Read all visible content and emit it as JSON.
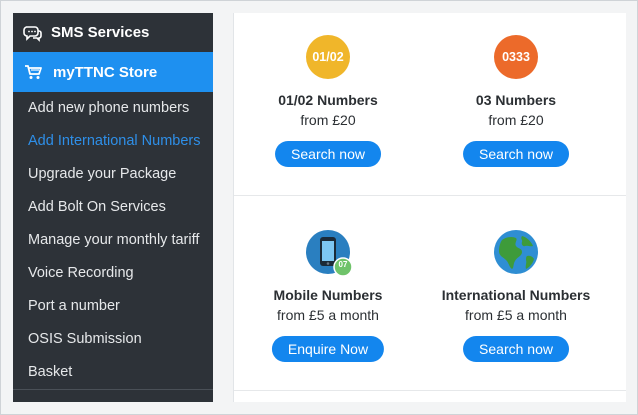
{
  "colors": {
    "sidebar_bg": "#2d3238",
    "active_blue": "#1e90f0",
    "link_blue": "#2e8fe8",
    "button_blue": "#1386ee",
    "badge_yellow": "#f0b62a",
    "badge_orange": "#ec6a2a"
  },
  "sidebar": {
    "header": {
      "label": "SMS Services",
      "icon": "chat-bubbles-icon"
    },
    "store": {
      "label": "myTTNC Store",
      "icon": "shopping-cart-icon"
    },
    "items": [
      {
        "label": "Add new phone numbers",
        "active": false
      },
      {
        "label": "Add International Numbers",
        "active": true
      },
      {
        "label": "Upgrade your Package",
        "active": false
      },
      {
        "label": "Add Bolt On Services",
        "active": false
      },
      {
        "label": "Manage your monthly tariff",
        "active": false
      },
      {
        "label": "Voice Recording",
        "active": false
      },
      {
        "label": "Port a number",
        "active": false
      },
      {
        "label": "OSIS Submission",
        "active": false
      },
      {
        "label": "Basket",
        "active": false
      }
    ]
  },
  "products": [
    {
      "badge": "01/02",
      "title": "01/02 Numbers",
      "price": "from £20",
      "button": "Search now"
    },
    {
      "badge": "0333",
      "title": "03 Numbers",
      "price": "from £20",
      "button": "Search now"
    },
    {
      "badge": "07",
      "icon": "mobile-phone-icon",
      "title": "Mobile Numbers",
      "price": "from £5 a month",
      "button": "Enquire Now"
    },
    {
      "icon": "globe-icon",
      "title": "International Numbers",
      "price": "from £5 a month",
      "button": "Search now"
    }
  ]
}
